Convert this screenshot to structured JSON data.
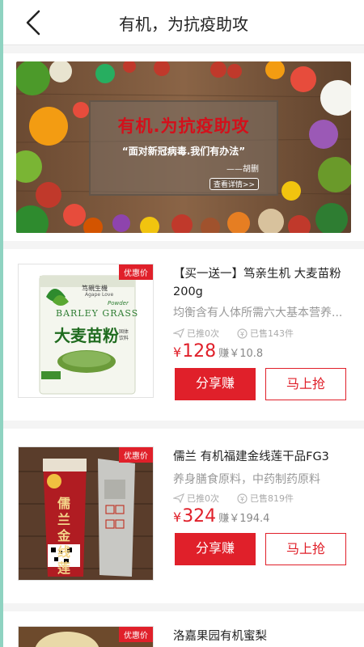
{
  "header": {
    "title": "有机，为抗疫助攻"
  },
  "banner": {
    "title": "有机.为抗疫助攻",
    "quote": "“面对新冠病毒.我们有办法”",
    "author": "——胡删",
    "detail": "查看详情>>"
  },
  "products": [
    {
      "badge": "优惠价",
      "title": "【买一送一】笃亲生机 大麦苗粉200g",
      "desc": "均衡含有人体所需六大基本营养...",
      "recommended": "已推0次",
      "sold": "已售143件",
      "currency": "¥",
      "price": "128",
      "earn": "赚￥10.8",
      "share_label": "分享赚",
      "buy_label": "马上抢",
      "can_brand": "笃親生機",
      "can_brand_en": "Agape Love",
      "can_text_en": "BARLEY GRASS",
      "can_text_powder": "Powder",
      "can_text_cn": "大麦苗粉",
      "can_sub": "固体饮料"
    },
    {
      "badge": "优惠价",
      "title": "儒兰 有机福建金线莲干品FG3",
      "desc": "养身膳食原料，中药制药原料",
      "recommended": "已推0次",
      "sold": "已售819件",
      "currency": "¥",
      "price": "324",
      "earn": "赚￥194.4",
      "share_label": "分享赚",
      "buy_label": "马上抢",
      "pack_text": "儒兰金线莲"
    },
    {
      "badge": "优惠价",
      "title": "洛嘉果园有机蜜梨"
    }
  ]
}
